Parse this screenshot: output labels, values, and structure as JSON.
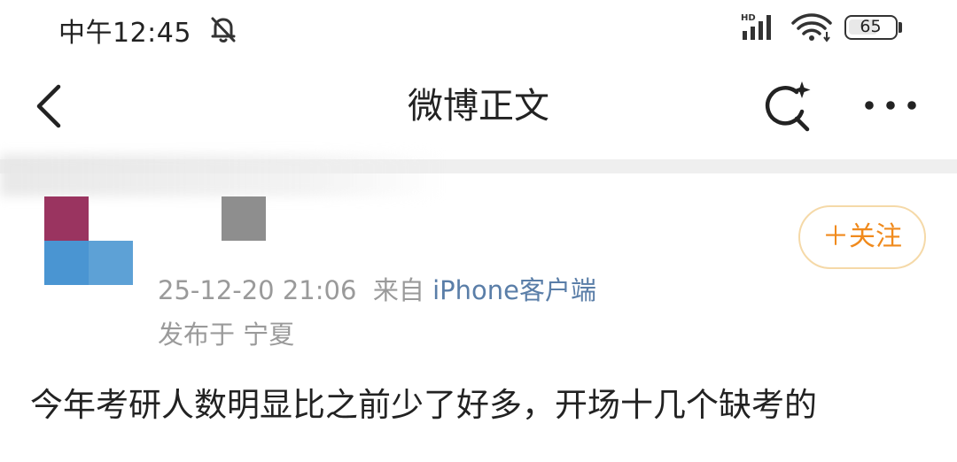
{
  "status_bar": {
    "time": "中午12:45",
    "network_label": "HD",
    "battery_level": 65,
    "battery_text": "65"
  },
  "nav": {
    "title": "微博正文",
    "back_icon": "chevron-left-icon",
    "search_icon": "search-sparkle-icon",
    "more_icon": "more-dots-icon"
  },
  "post": {
    "timestamp": "25-12-20 21:06",
    "source_prefix": "来自",
    "source": "iPhone客户端",
    "location": "发布于 宁夏",
    "follow_label": "＋关注",
    "body": "今年考研人数明显比之前少了好多，开场十几个缺考的"
  },
  "colors": {
    "accent_orange": "#f08a1c",
    "follow_border": "#f5d9a8",
    "source_link": "#5a7ea8",
    "meta_gray": "#9a9a9a"
  }
}
